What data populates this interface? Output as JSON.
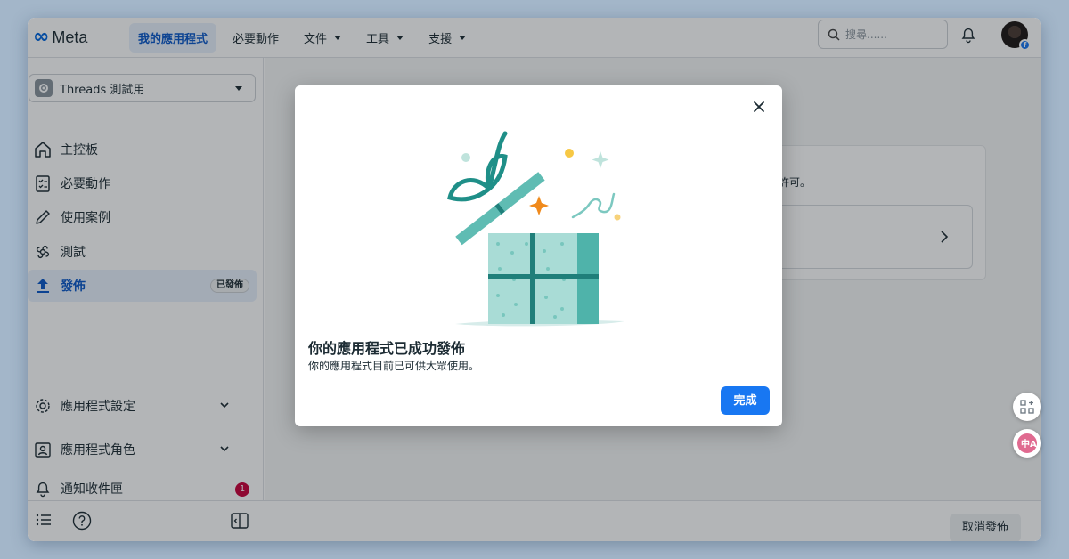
{
  "header": {
    "brand": "Meta",
    "nav": [
      {
        "label": "我的應用程式",
        "active": true
      },
      {
        "label": "必要動作"
      },
      {
        "label": "文件"
      },
      {
        "label": "工具"
      },
      {
        "label": "支援"
      }
    ],
    "search_placeholder": "搜尋......"
  },
  "sidebar": {
    "app_name": "Threads 測試用",
    "items": [
      {
        "label": "主控板",
        "icon": "home-icon"
      },
      {
        "label": "必要動作",
        "icon": "checklist-icon"
      },
      {
        "label": "使用案例",
        "icon": "pencil-icon"
      },
      {
        "label": "測試",
        "icon": "test-icon"
      },
      {
        "label": "發佈",
        "icon": "upload-icon",
        "badge": "已發佈",
        "active": true
      }
    ],
    "settings": [
      {
        "label": "應用程式設定",
        "icon": "gear-icon"
      },
      {
        "label": "應用程式角色",
        "icon": "roles-icon"
      },
      {
        "label": "通知收件匣",
        "icon": "bell-icon",
        "count": "1"
      }
    ]
  },
  "footer": {
    "unpublish_label": "取消發佈"
  },
  "background": {
    "card_text": "許可。"
  },
  "modal": {
    "title": "你的應用程式已成功發佈",
    "subtitle": "你的應用程式目前已可供大眾使用。",
    "done_label": "完成"
  },
  "colors": {
    "accent": "#1877f2",
    "active_nav_bg": "#e7f0fd",
    "gift_teal": "#3aa7a0",
    "badge_red": "#c9003a"
  }
}
